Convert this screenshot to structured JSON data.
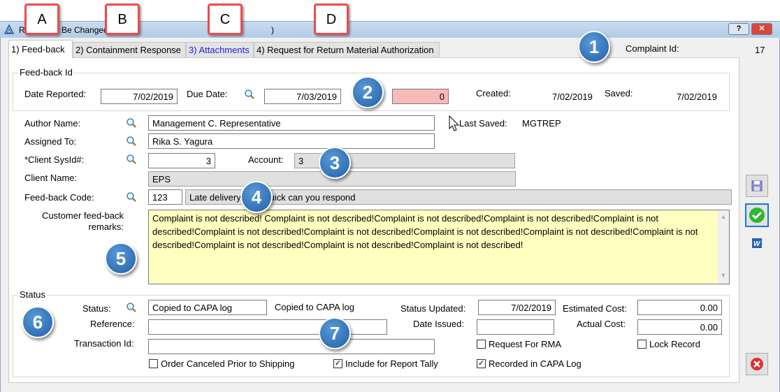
{
  "window": {
    "title_start": "R",
    "title_mid": "Be Changed",
    "title_end": ")",
    "help": "?",
    "close": "✕"
  },
  "tabs": [
    {
      "label": "1) Feed-back"
    },
    {
      "label": "2) Containment Response"
    },
    {
      "label": "3) Attachments"
    },
    {
      "label": "4) Request for Return Material Authorization"
    }
  ],
  "complaint": {
    "label": "Complaint Id:",
    "value": "17"
  },
  "feedback_id": {
    "legend": "Feed-back Id",
    "date_reported_label": "Date Reported:",
    "date_reported": "7/02/2019",
    "due_date_label": "Due Date:",
    "due_date": "7/03/2019",
    "counter": "0",
    "created_label": "Created:",
    "created": "7/02/2019",
    "saved_label": "Saved:",
    "saved": "7/02/2019"
  },
  "form": {
    "author_label": "Author Name:",
    "author": "Management C. Representative",
    "last_saved_label": "Last Saved:",
    "last_saved": "MGTREP",
    "assigned_label": "Assigned To:",
    "assigned": "Rika S. Yagura",
    "client_sysid_label": "*Client SysId#:",
    "client_sysid": "3",
    "account_label": "Account:",
    "account": "3",
    "client_name_label": "Client Name:",
    "client_name": "EPS",
    "code_label": "Feed-back Code:",
    "code": "123",
    "code_desc": "Late delivery, how quick can you respond",
    "remarks_label": "Customer feed-back remarks:",
    "remarks": "Complaint is not described! Complaint is not described!Complaint is not described!Complaint is not described!Complaint is not described!Complaint is not described!Complaint is not described!Complaint is not described!Complaint is not described!Complaint is not described!Complaint is not described!Complaint is not described!Complaint is not described!"
  },
  "status": {
    "legend": "Status",
    "status_label": "Status:",
    "status": "Copied to CAPA log",
    "status_text": "Copied to CAPA log",
    "status_updated_label": "Status Updated:",
    "status_updated": "7/02/2019",
    "est_cost_label": "Estimated Cost:",
    "est_cost": "0.00",
    "reference_label": "Reference:",
    "reference": "",
    "date_issued_label": "Date Issued:",
    "date_issued": "",
    "actual_cost_label": "Actual Cost:",
    "actual_cost": "0.00",
    "transaction_label": "Transaction Id:",
    "transaction": "",
    "rma_label": "Request For RMA",
    "rma_checked": false,
    "lock_label": "Lock Record",
    "lock_checked": false,
    "order_canceled_label": "Order Canceled Prior to Shipping",
    "order_canceled_checked": false,
    "report_tally_label": "Include for Report Tally",
    "report_tally_checked": true,
    "capa_label": "Recorded in CAPA Log",
    "capa_checked": true
  },
  "side_buttons": [
    "save-icon",
    "ok-check-icon",
    "word-icon",
    "cancel-icon"
  ],
  "callouts": {
    "letters": [
      "A",
      "B",
      "C",
      "D"
    ],
    "numbers": [
      "1",
      "2",
      "3",
      "4",
      "5",
      "6",
      "7"
    ]
  },
  "colors": {
    "callout_border": "#f04a4a",
    "circle": "#2f6fb8",
    "remarks_bg": "#ffffc0",
    "counter_bg": "#f9b9b9",
    "ok": "#2fb52f",
    "cancel": "#e03030"
  }
}
